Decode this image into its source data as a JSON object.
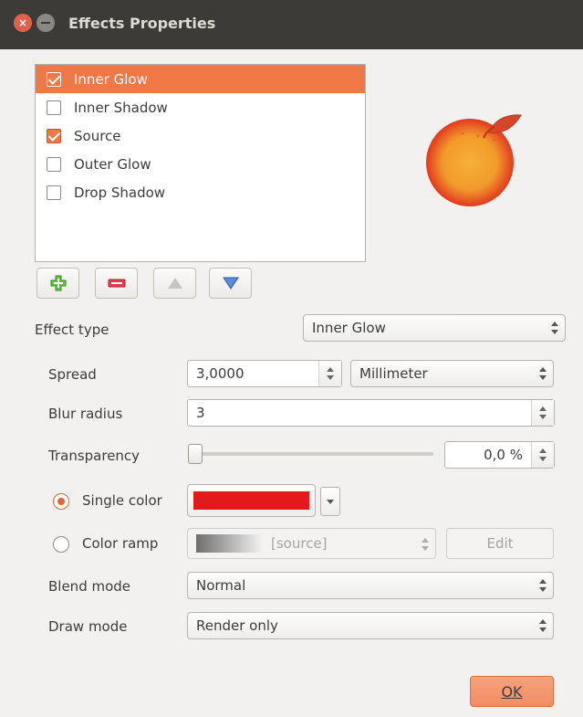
{
  "window": {
    "title": "Effects Properties",
    "close_glyph": "×"
  },
  "effects_list": [
    {
      "label": "Inner Glow",
      "checked": true,
      "selected": true
    },
    {
      "label": "Inner Shadow",
      "checked": false,
      "selected": false
    },
    {
      "label": "Source",
      "checked": true,
      "selected": false
    },
    {
      "label": "Outer Glow",
      "checked": false,
      "selected": false
    },
    {
      "label": "Drop Shadow",
      "checked": false,
      "selected": false
    }
  ],
  "list_buttons": [
    "add-icon",
    "remove-icon",
    "move-up-icon",
    "move-down-icon"
  ],
  "form": {
    "effect_type_label": "Effect type",
    "effect_type_value": "Inner Glow",
    "spread_label": "Spread",
    "spread_value": "3,0000",
    "spread_unit": "Millimeter",
    "blur_label": "Blur radius",
    "blur_value": "3",
    "transparency_label": "Transparency",
    "transparency_value": "0,0 %",
    "single_color_label": "Single color",
    "single_color_hex": "#e31a1c",
    "color_ramp_label": "Color ramp",
    "color_ramp_value": "[source]",
    "edit_label": "Edit",
    "blend_label": "Blend mode",
    "blend_value": "Normal",
    "draw_label": "Draw mode",
    "draw_value": "Render only"
  },
  "ok_label": "OK",
  "colors": {
    "accent": "#f07746",
    "titlebar": "#3c3b37"
  }
}
